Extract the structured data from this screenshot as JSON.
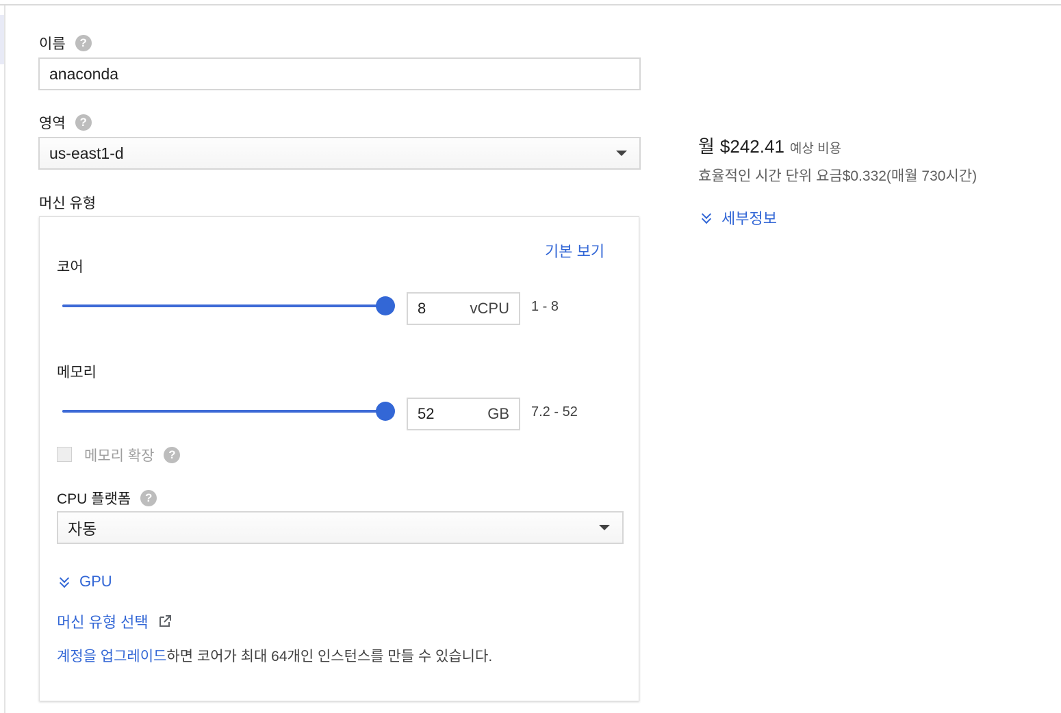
{
  "name_field": {
    "label": "이름",
    "value": "anaconda"
  },
  "region_field": {
    "label": "영역",
    "value": "us-east1-d"
  },
  "machine_type": {
    "label": "머신 유형",
    "basic_view_link": "기본 보기",
    "cores": {
      "label": "코어",
      "value": "8",
      "unit": "vCPU",
      "range": "1 - 8",
      "slider_fraction": 1.0
    },
    "memory": {
      "label": "메모리",
      "value": "52",
      "unit": "GB",
      "range": "7.2 - 52",
      "slider_fraction": 1.0
    },
    "extend_memory": {
      "label": "메모리 확장",
      "checked": false,
      "disabled": true
    },
    "cpu_platform": {
      "label": "CPU 플랫폼",
      "value": "자동"
    },
    "gpu_link": "GPU",
    "select_machine_link": "머신 유형 선택",
    "upgrade": {
      "link_text": "계정을 업그레이드",
      "rest_text": "하면 코어가 최대 64개인 인스턴스를 만들 수 있습니다."
    }
  },
  "pricing": {
    "month_prefix": "월",
    "monthly_cost": "$242.41",
    "estimate_label": "예상 비용",
    "hourly_text": "효율적인 시간 단위 요금$0.332(매월 730시간)",
    "details_link": "세부정보"
  },
  "colors": {
    "accent": "#3367d6",
    "border": "#d6d6d6",
    "help_icon": "#bdbdbd"
  },
  "icons": {
    "help": "question-circle-icon",
    "dropdown": "caret-down-icon",
    "expand": "double-chevron-down-icon",
    "external": "external-link-icon"
  }
}
